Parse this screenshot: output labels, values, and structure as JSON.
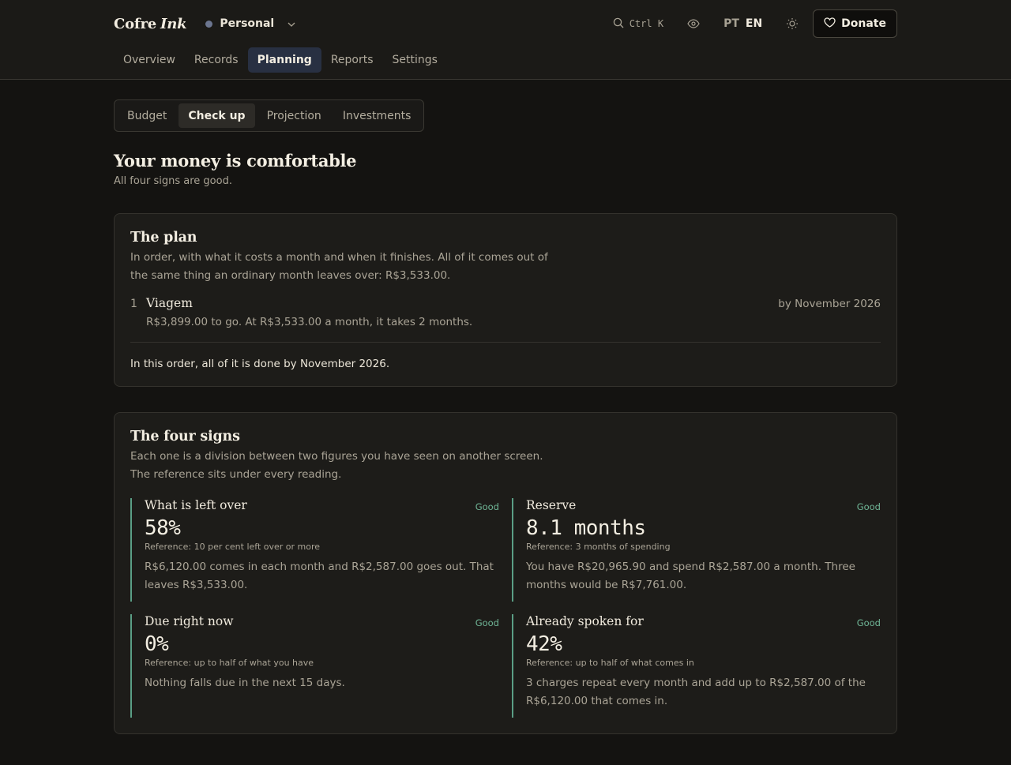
{
  "header": {
    "brand_main": "Cofre",
    "brand_italic": "Ink",
    "workspace": "Personal",
    "shortcut": "Ctrl K",
    "lang_pt": "PT",
    "lang_en": "EN",
    "donate_label": "Donate"
  },
  "nav": {
    "tabs": [
      "Overview",
      "Records",
      "Planning",
      "Reports",
      "Settings"
    ],
    "active": "Planning"
  },
  "subnav": {
    "tabs": [
      "Budget",
      "Check up",
      "Projection",
      "Investments"
    ],
    "active": "Check up"
  },
  "headline": {
    "title": "Your money is comfortable",
    "subtitle": "All four signs are good."
  },
  "plan": {
    "title": "The plan",
    "description": "In order, with what it costs a month and when it finishes. All of it comes out of the same thing an ordinary month leaves over: R$3,533.00.",
    "items": [
      {
        "num": "1",
        "name": "Viagem",
        "detail": "R$3,899.00 to go. At R$3,533.00 a month, it takes 2 months.",
        "when": "by November 2026"
      }
    ],
    "summary": "In this order, all of it is done by November 2026."
  },
  "signs": {
    "title": "The four signs",
    "description": "Each one is a division between two figures you have seen on another screen. The reference sits under every reading.",
    "items": [
      {
        "title": "What is left over",
        "status": "Good",
        "value": "58%",
        "reference": "Reference: 10 per cent left over or more",
        "body": "R$6,120.00 comes in each month and R$2,587.00 goes out. That leaves R$3,533.00."
      },
      {
        "title": "Reserve",
        "status": "Good",
        "value": "8.1 months",
        "reference": "Reference: 3 months of spending",
        "body": "You have R$20,965.90 and spend R$2,587.00 a month. Three months would be R$7,761.00."
      },
      {
        "title": "Due right now",
        "status": "Good",
        "value": "0%",
        "reference": "Reference: up to half of what you have",
        "body": "Nothing falls due in the next 15 days."
      },
      {
        "title": "Already spoken for",
        "status": "Good",
        "value": "42%",
        "reference": "Reference: up to half of what comes in",
        "body": "3 charges repeat every month and add up to R$2,587.00 of the R$6,120.00 that comes in."
      }
    ]
  },
  "colors": {
    "accent_good": "#6fb596",
    "active_tab_bg": "#283042"
  }
}
